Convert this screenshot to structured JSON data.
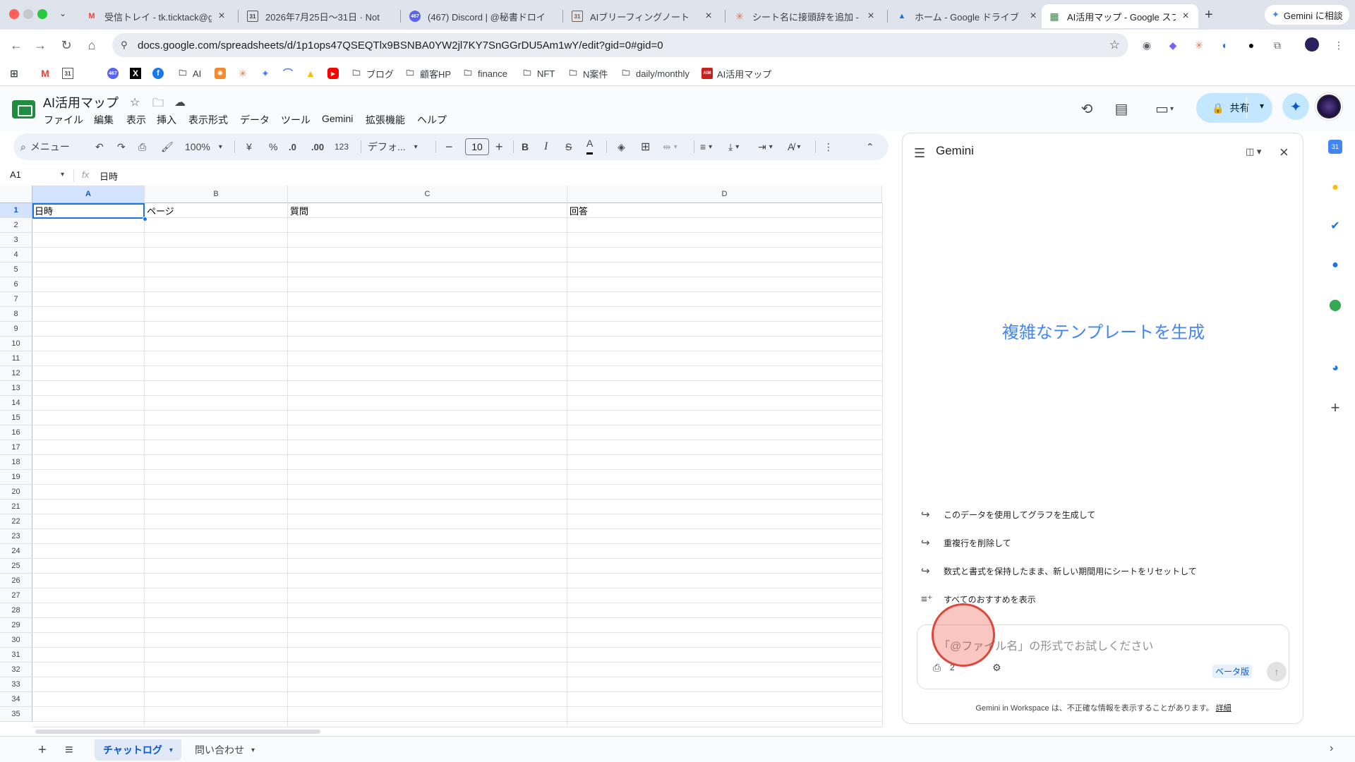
{
  "browser": {
    "tabs": [
      {
        "title": "受信トレイ - tk.ticktack@gm",
        "favicon": "M",
        "color": "#ea4335"
      },
      {
        "title": "2026年7月25日〜31日 · Not",
        "favicon": "31",
        "color": "#202124"
      },
      {
        "title": "(467) Discord | @秘書ドロイ",
        "favicon": "467",
        "color": "#5865f2"
      },
      {
        "title": "AIブリーフィングノート",
        "favicon": "31",
        "color": "#7a5a48"
      },
      {
        "title": "シート名に接頭辞を追加 - Cla",
        "favicon": "✳",
        "color": "#d97757"
      },
      {
        "title": "ホーム - Google ドライブ",
        "favicon": "▲",
        "color": "#1a73e8"
      },
      {
        "title": "AI活用マップ - Google スプレ",
        "favicon": "▦",
        "color": "#1e8e3e"
      }
    ],
    "new_tab": "+",
    "gemini_chip": "Gemini に相談",
    "url": "docs.google.com/spreadsheets/d/1p1ops47QSEQTlx9BSNBA0YW2jl7KY7SnGGrDU5Am1wY/edit?gid=0#gid=0",
    "bookmarks": [
      {
        "label": "AI",
        "icon": "folder-icon"
      },
      {
        "label": "ブログ",
        "icon": "folder-icon"
      },
      {
        "label": "顧客HP",
        "icon": "folder-icon"
      },
      {
        "label": "finance",
        "icon": "folder-icon"
      },
      {
        "label": "NFT",
        "icon": "folder-icon"
      },
      {
        "label": "N案件",
        "icon": "folder-icon"
      },
      {
        "label": "daily/monthly",
        "icon": "folder-icon"
      },
      {
        "label": "AI活用マップ",
        "icon": "ai-map-icon"
      }
    ]
  },
  "doc": {
    "title": "AI活用マップ",
    "menus": [
      "ファイル",
      "編集",
      "表示",
      "挿入",
      "表示形式",
      "データ",
      "ツール",
      "Gemini",
      "拡張機能",
      "ヘルプ"
    ],
    "share_label": "共有"
  },
  "format_bar": {
    "search_label": "メニュー",
    "zoom": "100%",
    "currency": "¥",
    "percent": "%",
    "dec_decrease": ".0",
    "dec_increase": ".00",
    "number_format": "123",
    "font": "デフォ...",
    "font_size": "10",
    "bold": "B",
    "italic": "I",
    "strike": "S",
    "text_color": "A"
  },
  "formula_bar": {
    "name_box": "A1",
    "fx": "fx",
    "value": "日時"
  },
  "grid": {
    "columns": [
      "A",
      "B",
      "C",
      "D"
    ],
    "selected_column": "A",
    "rows": [
      "1",
      "2",
      "3",
      "4",
      "5",
      "6",
      "7",
      "8",
      "9",
      "10",
      "11",
      "12",
      "13",
      "14",
      "15",
      "16",
      "17",
      "18",
      "19",
      "20",
      "21",
      "22",
      "23",
      "24",
      "25",
      "26",
      "27",
      "28",
      "29",
      "30",
      "31",
      "32",
      "33",
      "34",
      "35"
    ],
    "selected_row": "1",
    "cells": {
      "A1": "日時",
      "B1": "ページ",
      "C1": "質問",
      "D1": "回答"
    }
  },
  "sheets": {
    "tabs": [
      {
        "label": "チャットログ",
        "active": true
      },
      {
        "label": "問い合わせ",
        "active": false
      }
    ]
  },
  "gemini": {
    "title": "Gemini",
    "headline": "複雑なテンプレートを生成",
    "suggestions": [
      "このデータを使用してグラフを生成して",
      "重複行を削除して",
      "数式と書式を保持したまま、新しい期間用にシートをリセットして"
    ],
    "show_all": "すべてのおすすめを表示",
    "input_placeholder": "「@ファイル名」の形式でお試しください",
    "beta_label": "ベータ版",
    "attach_count": "2",
    "disclaimer": "Gemini in Workspace は、不正確な情報を表示することがあります。",
    "disclaimer_link": "詳細"
  },
  "colors": {
    "accent": "#0b57d0",
    "share_bg": "#c2e7ff",
    "selection": "#1a73e8",
    "sheets_green": "#1e8e3e",
    "gemini_headline": "#4285f4"
  }
}
